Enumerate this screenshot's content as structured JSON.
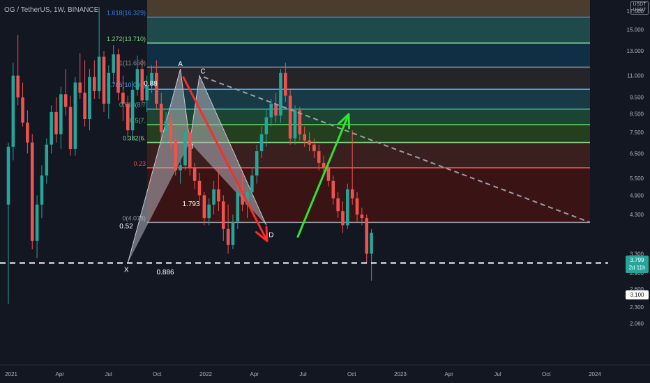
{
  "header": {
    "symbol": "OG / TetherUS, 1W, BINANCE",
    "currency_box": [
      "USDT",
      "USDT"
    ]
  },
  "price_tags": {
    "last_price": "3.799",
    "countdown": "2d 11h",
    "support_line": "3.100"
  },
  "colors": {
    "background": "#131722",
    "bull": "#26a69a",
    "bear": "#ef5350",
    "arrow_down": "#ff2a2a",
    "arrow_up": "#2ee52e"
  },
  "chart_data": {
    "type": "candlestick",
    "scale": "log",
    "y_range": [
      2.0,
      19.0
    ],
    "y_ticks": [
      "19.000",
      "17.000",
      "15.000",
      "13.000",
      "11.000",
      "9.500",
      "8.500",
      "7.500",
      "6.500",
      "5.500",
      "4.900",
      "4.300",
      "3.300",
      "2.900",
      "2.600",
      "2.300",
      "2.060"
    ],
    "x_ticks": [
      "2021",
      "Apr",
      "Jul",
      "Oct",
      "2022",
      "Apr",
      "Jul",
      "Oct",
      "2023",
      "Apr",
      "Jul",
      "Oct",
      "2024"
    ],
    "candles_ohlc": [
      [
        4.6,
        7.0,
        2.35,
        6.8
      ],
      [
        6.8,
        12.0,
        6.2,
        11.0
      ],
      [
        11.0,
        14.5,
        9.0,
        9.5
      ],
      [
        9.5,
        10.5,
        7.8,
        8.0
      ],
      [
        8.0,
        8.7,
        6.5,
        7.0
      ],
      [
        7.0,
        7.4,
        3.4,
        3.6
      ],
      [
        3.6,
        4.9,
        3.2,
        4.6
      ],
      [
        4.6,
        6.0,
        4.2,
        5.6
      ],
      [
        5.6,
        7.2,
        5.3,
        6.9
      ],
      [
        6.9,
        9.0,
        6.5,
        8.6
      ],
      [
        8.6,
        9.5,
        7.0,
        7.4
      ],
      [
        7.4,
        10.2,
        6.7,
        9.7
      ],
      [
        9.7,
        11.5,
        8.4,
        8.9
      ],
      [
        8.9,
        9.6,
        6.4,
        6.7
      ],
      [
        6.7,
        10.9,
        6.4,
        10.5
      ],
      [
        10.5,
        12.8,
        9.4,
        9.8
      ],
      [
        9.8,
        12.2,
        7.8,
        8.2
      ],
      [
        8.2,
        11.5,
        7.6,
        10.9
      ],
      [
        10.9,
        12.2,
        9.4,
        9.9
      ],
      [
        9.9,
        17.5,
        9.4,
        12.5
      ],
      [
        12.5,
        13.0,
        8.6,
        9.1
      ],
      [
        9.1,
        11.8,
        8.2,
        11.2
      ],
      [
        11.2,
        13.5,
        10.4,
        12.7
      ],
      [
        12.7,
        13.2,
        9.3,
        9.8
      ],
      [
        9.8,
        11.0,
        8.1,
        9.1
      ],
      [
        9.1,
        9.6,
        7.2,
        7.6
      ],
      [
        7.6,
        10.6,
        7.1,
        10.0
      ],
      [
        10.0,
        12.6,
        9.6,
        11.5
      ],
      [
        11.5,
        12.3,
        9.0,
        9.3
      ],
      [
        9.3,
        11.0,
        8.6,
        10.3
      ],
      [
        10.3,
        11.8,
        9.8,
        11.2
      ],
      [
        11.2,
        12.2,
        8.8,
        9.1
      ],
      [
        9.1,
        9.8,
        7.2,
        7.5
      ],
      [
        7.5,
        8.6,
        6.9,
        8.1
      ],
      [
        8.1,
        8.5,
        6.7,
        7.1
      ],
      [
        7.1,
        7.4,
        5.6,
        5.8
      ],
      [
        5.8,
        6.4,
        5.3,
        6.0
      ],
      [
        6.0,
        7.9,
        5.8,
        7.5
      ],
      [
        7.5,
        7.8,
        5.6,
        5.9
      ],
      [
        5.9,
        6.1,
        5.1,
        5.4
      ],
      [
        5.4,
        5.7,
        4.7,
        4.9
      ],
      [
        4.9,
        5.0,
        4.0,
        4.2
      ],
      [
        4.2,
        4.8,
        4.0,
        4.6
      ],
      [
        4.6,
        5.4,
        4.3,
        5.1
      ],
      [
        5.1,
        6.0,
        4.4,
        4.7
      ],
      [
        4.7,
        4.9,
        3.6,
        3.9
      ],
      [
        3.9,
        4.6,
        3.3,
        3.5
      ],
      [
        3.5,
        4.3,
        3.4,
        4.1
      ],
      [
        4.1,
        5.3,
        3.9,
        5.0
      ],
      [
        5.0,
        5.7,
        4.4,
        4.6
      ],
      [
        4.6,
        5.2,
        4.2,
        5.0
      ],
      [
        5.0,
        5.9,
        4.7,
        5.6
      ],
      [
        5.6,
        6.9,
        5.3,
        6.6
      ],
      [
        6.6,
        7.8,
        6.3,
        7.4
      ],
      [
        7.4,
        8.8,
        6.8,
        8.3
      ],
      [
        8.3,
        9.4,
        7.8,
        9.1
      ],
      [
        9.1,
        9.8,
        8.0,
        8.4
      ],
      [
        8.4,
        11.5,
        8.0,
        11.2
      ],
      [
        11.2,
        12.0,
        9.2,
        9.6
      ],
      [
        9.6,
        10.1,
        6.9,
        7.2
      ],
      [
        7.2,
        9.0,
        6.9,
        8.7
      ],
      [
        8.7,
        8.9,
        7.1,
        7.4
      ],
      [
        7.4,
        7.8,
        6.8,
        7.1
      ],
      [
        7.1,
        7.5,
        6.6,
        6.9
      ],
      [
        6.9,
        7.2,
        6.3,
        6.6
      ],
      [
        6.6,
        6.9,
        5.8,
        6.1
      ],
      [
        6.1,
        6.4,
        5.6,
        5.9
      ],
      [
        5.9,
        6.2,
        5.2,
        5.4
      ],
      [
        5.4,
        5.6,
        4.6,
        4.8
      ],
      [
        4.8,
        5.0,
        4.2,
        4.4
      ],
      [
        4.4,
        4.7,
        3.8,
        4.0
      ],
      [
        4.0,
        5.3,
        3.9,
        5.1
      ],
      [
        5.1,
        7.6,
        4.6,
        4.8
      ],
      [
        4.8,
        5.0,
        4.1,
        4.3
      ],
      [
        4.3,
        4.5,
        4.0,
        4.2
      ],
      [
        4.2,
        4.3,
        3.1,
        3.3
      ],
      [
        3.3,
        3.9,
        2.75,
        3.8
      ]
    ],
    "fib_levels": [
      {
        "label": "1.618(16.329)",
        "value": 16.329,
        "line": "#2f84d6",
        "fill": "#1f4a4c"
      },
      {
        "label": "1.272(13.710)",
        "value": 13.71,
        "line": "#7fd67f",
        "fill": "#0f2f45"
      },
      {
        "label": "1(11.650)",
        "value": 11.65,
        "line": "#8a8d96",
        "fill": "#242429"
      },
      {
        "label": "0.786(10.030)",
        "value": 10.03,
        "line": "#4aa3f0",
        "fill": "#173a45"
      },
      {
        "label": "0.618(8.7",
        "value": 8.77,
        "line": "#3fb6a4",
        "fill": "#1c4433"
      },
      {
        "label": "0.5(7.",
        "value": 7.9,
        "line": "#5cc85c",
        "fill": "#233f1e"
      },
      {
        "label": "0.382(6.",
        "value": 7.0,
        "line": "#8ad88a",
        "fill": "#3a1f1f"
      },
      {
        "label": "0.23",
        "value": 5.9,
        "line": "#ef4b4b",
        "fill": "#3a1414"
      },
      {
        "label": "0(4.078)",
        "value": 4.078,
        "line": "#9598a1",
        "fill": ""
      }
    ],
    "fib_top_fill": "#4a3d2d",
    "harmonic_points": [
      {
        "name": "X",
        "week": 25,
        "price": 3.1
      },
      {
        "name": "A",
        "week": 36,
        "price": 11.5
      },
      {
        "name": "B",
        "week": 38,
        "price": 7.0
      },
      {
        "name": "C",
        "week": 40,
        "price": 11.0
      },
      {
        "name": "D",
        "week": 54,
        "price": 4.0
      }
    ],
    "ratio_labels": [
      "0.52",
      "0.88",
      "1.793",
      "0.886"
    ],
    "support_level": 3.1
  }
}
